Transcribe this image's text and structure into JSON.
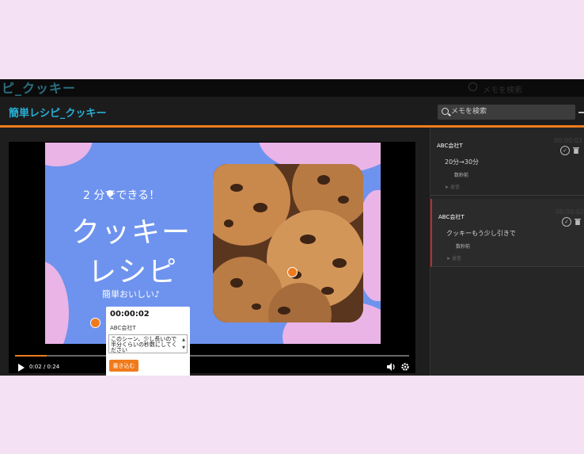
{
  "app": {
    "ghost_title": "ピ_クッキー",
    "ghost_search_placeholder": "メモを検索",
    "title": "簡単レシピ_クッキー",
    "search_placeholder": "メモを検索"
  },
  "colors": {
    "accent": "#f07b1c",
    "title": "#27b0d6",
    "slide_blue": "#6e93ee",
    "slide_pink": "#eab4e6"
  },
  "slide": {
    "badge": "2 分でできる！",
    "title_line1": "クッキー",
    "title_line2": "レシピ",
    "subtitle": "簡単おいしい♪"
  },
  "player": {
    "time": "0:02 / 0:24",
    "progress": 0.08,
    "icons": [
      "play-icon",
      "volume-icon",
      "settings-icon"
    ]
  },
  "memo_popup": {
    "time": "00:00:02",
    "author": "ABC会社T",
    "text": "このシーン、少し長いので半分くらいの秒数にしてください",
    "submit_label": "書き込む"
  },
  "memos": [
    {
      "author": "ABC会社T",
      "time": "00:00:02",
      "body": "20分→30分",
      "ago": "数秒前",
      "reply_label": "返信"
    },
    {
      "author": "ABC会社T",
      "time": "00:00:02",
      "body": "クッキーもう少し引きで",
      "ago": "数秒前",
      "reply_label": "返信"
    }
  ]
}
